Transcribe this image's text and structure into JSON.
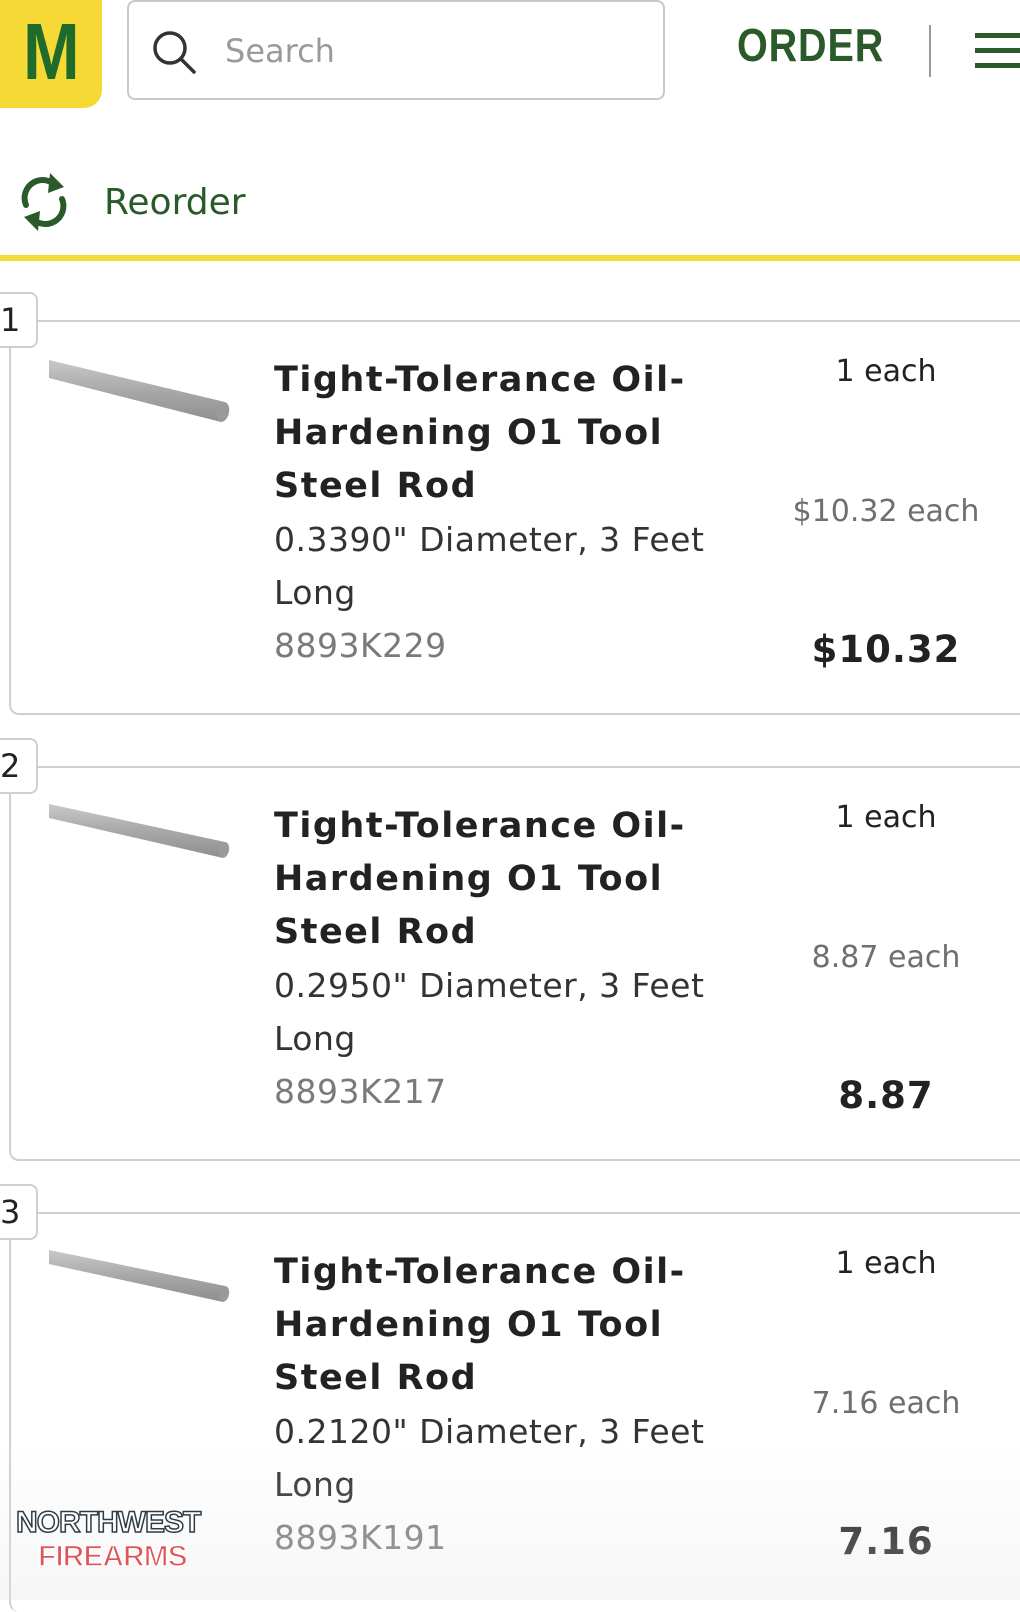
{
  "header": {
    "logo_letter": "M",
    "search_placeholder": "Search",
    "order_label": "ORDER",
    "brand_color": "#f6d934",
    "accent_color": "#2a5a2a"
  },
  "toolbar": {
    "reorder_label": "Reorder",
    "icons": [
      "search-icon",
      "menu-icon",
      "reorder-icon"
    ]
  },
  "items": [
    {
      "number": "1",
      "title": "Tight-Tolerance Oil-Hardening O1 Tool Steel Rod",
      "spec": "0.3390\" Diameter, 3 Feet Long",
      "part": "8893K229",
      "quantity": "1 each",
      "unit_price": "$10.32 each",
      "total": "$10.32"
    },
    {
      "number": "2",
      "title": "Tight-Tolerance Oil-Hardening O1 Tool Steel Rod",
      "spec": "0.2950\" Diameter, 3 Feet Long",
      "part": "8893K217",
      "quantity": "1 each",
      "unit_price": "8.87 each",
      "total": "8.87"
    },
    {
      "number": "3",
      "title": "Tight-Tolerance Oil-Hardening O1 Tool Steel Rod",
      "spec": "0.2120\" Diameter, 3 Feet Long",
      "part": "8893K191",
      "quantity": "1 each",
      "unit_price": "7.16 each",
      "total": "7.16"
    }
  ],
  "watermark": {
    "line1": "NORTHWEST",
    "line2": "FIREARMS"
  }
}
